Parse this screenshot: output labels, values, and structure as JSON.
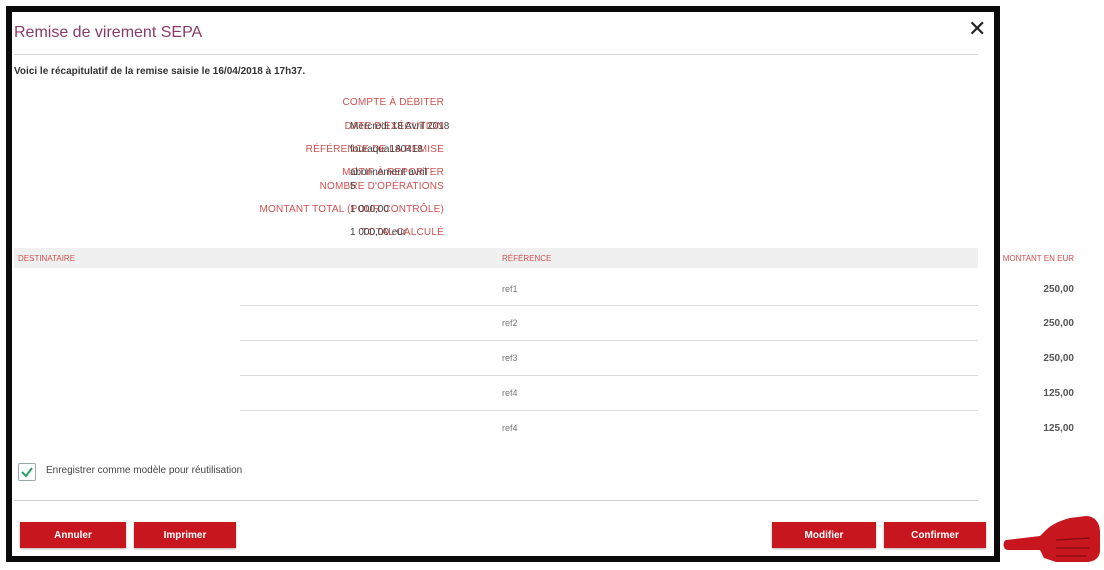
{
  "dialog": {
    "title": "Remise de virement SEPA",
    "close_symbol": "✕",
    "summary": "Voici le récapitulatif de la remise saisie le 16/04/2018 à 17h37."
  },
  "details": [
    {
      "label": "COMPTE À DÉBITER",
      "value": ""
    },
    {
      "label": "DATE D'EXÉCUTION",
      "value": "Mercredi 18 Avril 2018"
    },
    {
      "label": "RÉFÉRENCE DE LA REMISE",
      "value": "fouraqua180418"
    },
    {
      "label": "MOTIF À REPORTER",
      "value": "abonnement avril"
    },
    {
      "label": "NOMBRE D'OPÉRATIONS",
      "value": "5"
    },
    {
      "label": "MONTANT TOTAL (POUR CONTRÔLE)",
      "value": "1 000,00"
    },
    {
      "label": "TOTAL CALCULÉ",
      "value": "1 000,00 eur"
    }
  ],
  "table": {
    "headers": {
      "recipient": "DESTINATAIRE",
      "reference": "RÉFÉRENCE",
      "amount": "MONTANT EN EUR"
    },
    "rows": [
      {
        "recipient": "",
        "reference": "ref1",
        "amount": "250,00"
      },
      {
        "recipient": "",
        "reference": "ref2",
        "amount": "250,00"
      },
      {
        "recipient": "",
        "reference": "ref3",
        "amount": "250,00"
      },
      {
        "recipient": "",
        "reference": "ref4",
        "amount": "125,00"
      },
      {
        "recipient": "",
        "reference": "ref4",
        "amount": "125,00"
      }
    ]
  },
  "save_template": {
    "label": "Enregistrer comme modèle pour réutilisation",
    "checked": true
  },
  "buttons": {
    "cancel": "Annuler",
    "print": "Imprimer",
    "modify": "Modifier",
    "confirm": "Confirmer"
  },
  "colors": {
    "accent": "#c8161e",
    "label": "#d05050",
    "title": "#8a3a6a",
    "check": "#2e9e6a"
  },
  "icons": {
    "close": "close-icon",
    "check": "checkmark-icon",
    "pointer": "pointing-hand-icon"
  }
}
